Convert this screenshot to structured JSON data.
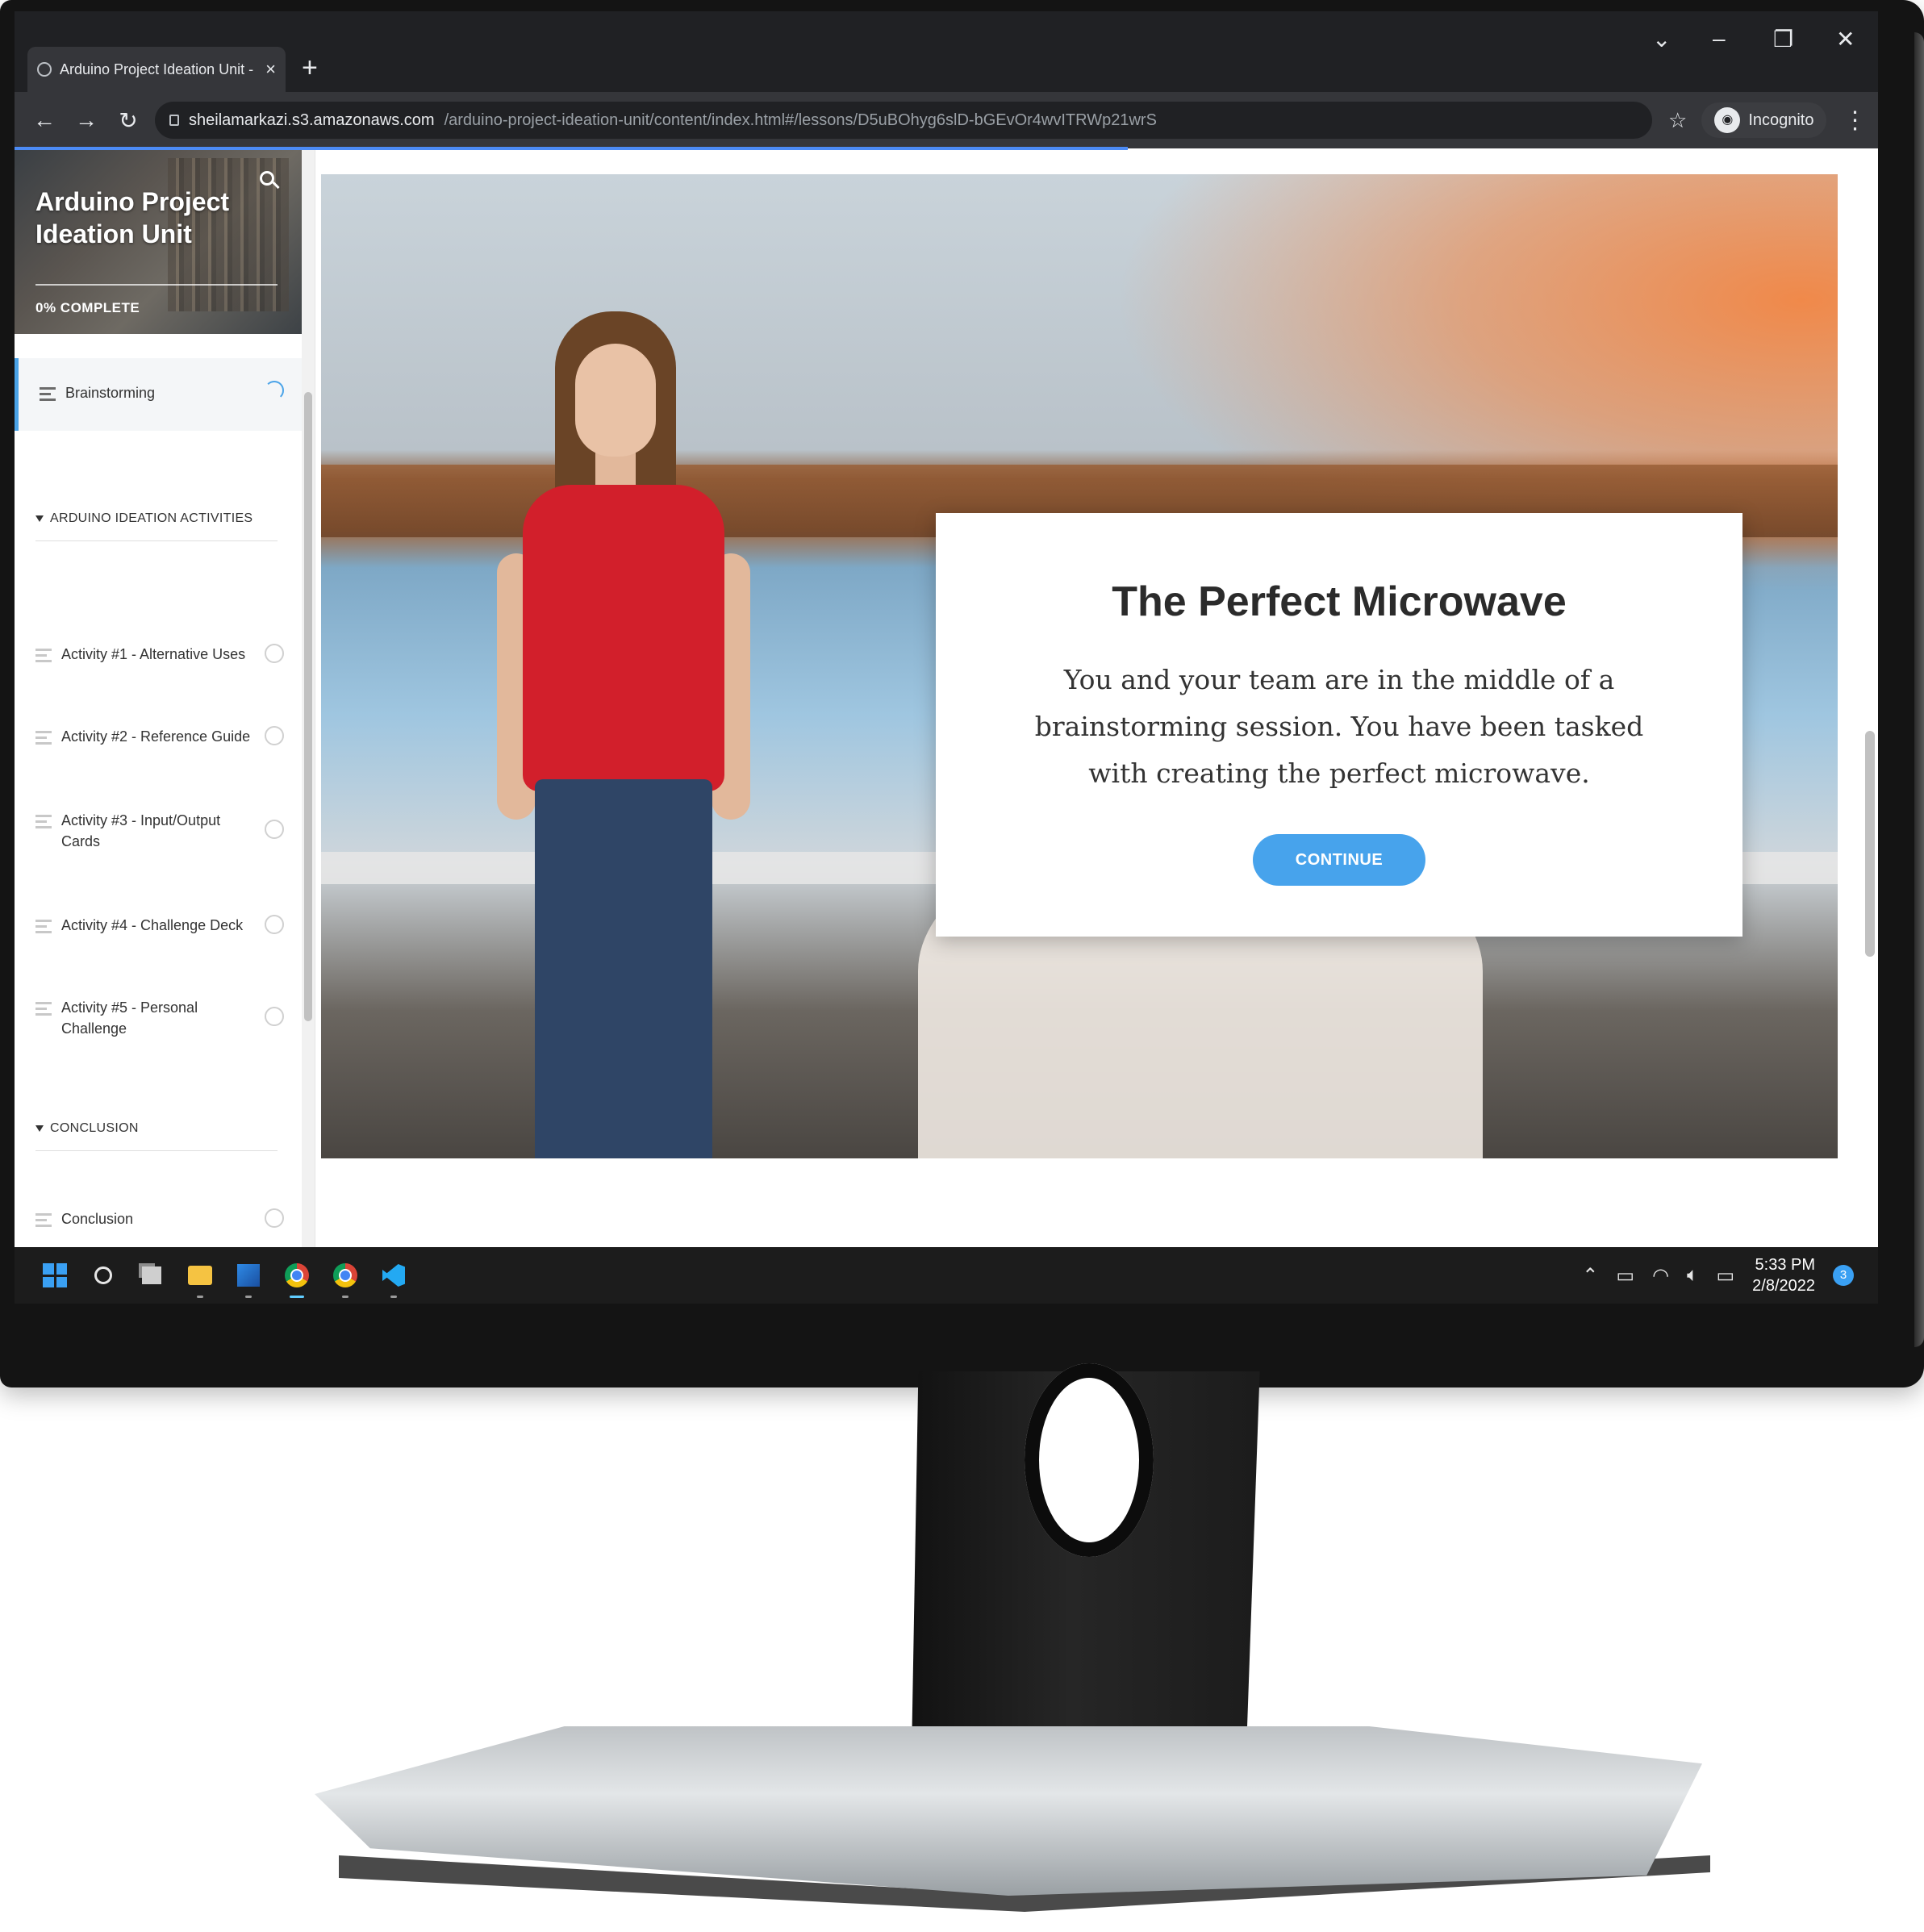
{
  "browser": {
    "tab_title": "Arduino Project Ideation Unit - B",
    "tab_close": "×",
    "new_tab": "+",
    "url_host": "sheilamarkazi.s3.amazonaws.com",
    "url_path": "/arduino-project-ideation-unit/content/index.html#/lessons/D5uBOhyg6slD-bGEvOr4wvITRWp21wrS",
    "profile_label": "Incognito",
    "window_controls": {
      "dropdown": "⌄",
      "minimize": "–",
      "restore": "❐",
      "close": "✕"
    },
    "nav": {
      "back": "←",
      "forward": "→",
      "reload": "↻"
    },
    "star": "☆",
    "menu": "⋮"
  },
  "sidebar": {
    "course_title": "Arduino Project Ideation Unit",
    "progress_label": "0% COMPLETE",
    "progress_percent": 0,
    "current_lesson": "Brainstorming",
    "sections": [
      {
        "title": "ARDUINO IDEATION ACTIVITIES",
        "lessons": [
          "Activity #1 - Alternative Uses",
          "Activity #2 - Reference Guide",
          "Activity #3 - Input/Output Cards",
          "Activity #4 - Challenge Deck",
          "Activity #5 - Personal Challenge"
        ]
      },
      {
        "title": "CONCLUSION",
        "lessons": [
          "Conclusion"
        ]
      }
    ]
  },
  "modal": {
    "title": "The Perfect Microwave",
    "body": "You and your team are in the middle of a brainstorming session. You have been tasked with creating the perfect microwave.",
    "button": "CONTINUE"
  },
  "taskbar": {
    "time": "5:33 PM",
    "date": "2/8/2022",
    "notification_count": "3",
    "apps": [
      "start-icon",
      "search-icon",
      "task-view-icon",
      "file-explorer-icon",
      "photos-icon",
      "chrome-icon",
      "chrome-incognito-icon",
      "vscode-icon"
    ]
  },
  "colors": {
    "accent": "#47a3ec",
    "chrome_dark": "#202124",
    "taskbar": "#1c1c1c"
  }
}
